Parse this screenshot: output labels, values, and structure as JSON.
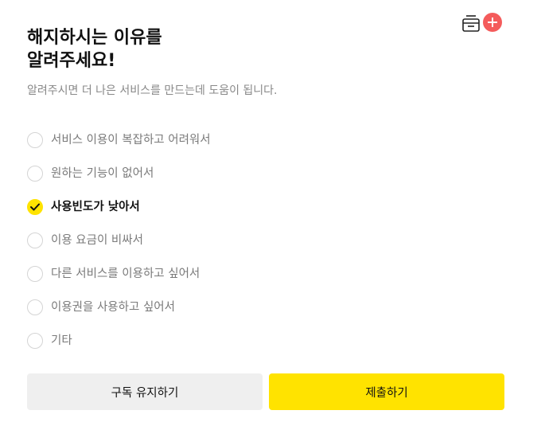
{
  "header": {
    "badge_icon": "archive-plus-icon",
    "badge_color": "#f45b5b",
    "title_line1": "해지하시는 이유를",
    "title_line2": "알려주세요!",
    "subtitle": "알려주시면 더 나은 서비스를 만드는데 도움이 됩니다."
  },
  "options": [
    {
      "label": "서비스 이용이 복잡하고 어려워서",
      "selected": false
    },
    {
      "label": "원하는 기능이 없어서",
      "selected": false
    },
    {
      "label": "사용빈도가 낮아서",
      "selected": true
    },
    {
      "label": "이용 요금이 비싸서",
      "selected": false
    },
    {
      "label": "다른 서비스를 이용하고 싶어서",
      "selected": false
    },
    {
      "label": "이용권을 사용하고 싶어서",
      "selected": false
    },
    {
      "label": "기타",
      "selected": false
    }
  ],
  "footer": {
    "keep_label": "구독 유지하기",
    "submit_label": "제출하기"
  },
  "colors": {
    "accent": "#ffe300",
    "secondary_button": "#efefef",
    "muted_text": "#888888"
  }
}
